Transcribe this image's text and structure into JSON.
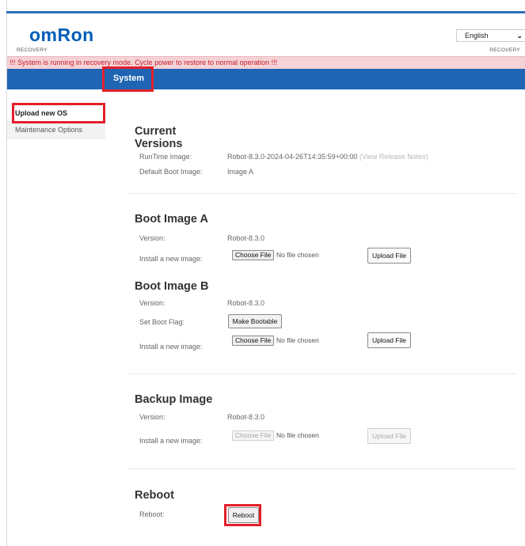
{
  "header": {
    "logo": "omRon",
    "recovery_left": "RECOVERY",
    "recovery_right": "RECOVERY",
    "language": "English"
  },
  "warning": "!!! System is running in recovery mode. Cycle power to restore to normal operation !!!",
  "nav": {
    "system_tab": "System"
  },
  "sidebar": {
    "items": [
      {
        "label": "Upload new OS"
      },
      {
        "label": "Maintenance Options"
      }
    ]
  },
  "current_versions": {
    "title_line1": "Current",
    "title_line2": "Versions",
    "runtime_label": "RunTime Image:",
    "runtime_value": "Robot-8.3.0-2024-04-26T14:35:59+00:00",
    "release_notes": "(View Release Notes)",
    "default_boot_label": "Default Boot Image:",
    "default_boot_value": "Image A"
  },
  "boot_a": {
    "title": "Boot Image A",
    "version_label": "Version:",
    "version_value": "Robot-8.3.0",
    "install_label": "Install a new image:",
    "choose_file": "Choose File",
    "no_file": "No file chosen",
    "upload": "Upload File"
  },
  "boot_b": {
    "title": "Boot Image B",
    "version_label": "Version:",
    "version_value": "Robot-8.3.0",
    "flag_label": "Set Boot Flag:",
    "make_bootable": "Make Bootable",
    "install_label": "Install a new image:",
    "choose_file": "Choose File",
    "no_file": "No file chosen",
    "upload": "Upload File"
  },
  "backup": {
    "title": "Backup Image",
    "version_label": "Version:",
    "version_value": "Robot-8.3.0",
    "install_label": "Install a new image:",
    "choose_file": "Choose File",
    "no_file": "No file chosen",
    "upload": "Upload File"
  },
  "reboot": {
    "title": "Reboot",
    "label": "Reboot:",
    "button": "Reboot"
  },
  "colors": {
    "brand_blue": "#005eb8",
    "nav_blue": "#1f65b4",
    "warning_bg": "#f5d2d6",
    "warning_text": "#c4202b",
    "highlight_red": "#e4202a"
  }
}
